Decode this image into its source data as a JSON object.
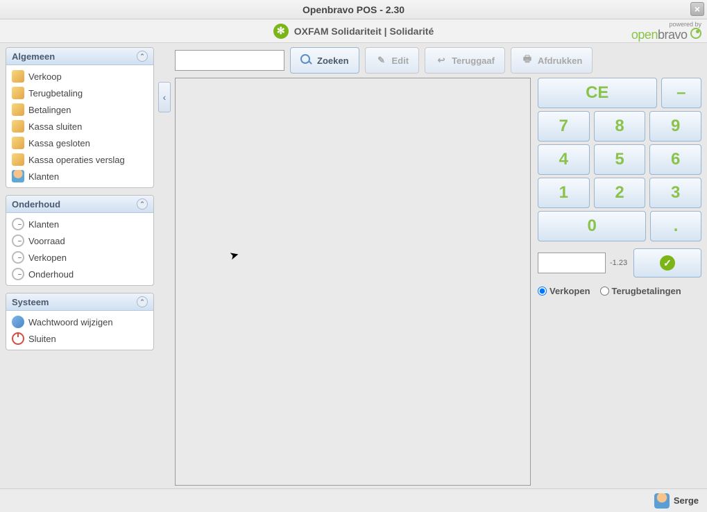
{
  "window": {
    "title": "Openbravo POS - 2.30"
  },
  "header": {
    "org": "OXFAM Solidariteit | Solidarité",
    "brand_small": "powered by",
    "brand_name1": "open",
    "brand_name2": "bravo"
  },
  "sidebar": {
    "sections": [
      {
        "title": "Algemeen",
        "items": [
          {
            "label": "Verkoop",
            "icon": "sale-icon"
          },
          {
            "label": "Terugbetaling",
            "icon": "refund-icon"
          },
          {
            "label": "Betalingen",
            "icon": "payments-icon"
          },
          {
            "label": "Kassa sluiten",
            "icon": "close-cash-icon"
          },
          {
            "label": "Kassa gesloten",
            "icon": "cash-closed-icon"
          },
          {
            "label": "Kassa operaties verslag",
            "icon": "cash-report-icon"
          },
          {
            "label": "Klanten",
            "icon": "customers-icon"
          }
        ]
      },
      {
        "title": "Onderhoud",
        "items": [
          {
            "label": "Klanten",
            "icon": "customers-maint-icon"
          },
          {
            "label": "Voorraad",
            "icon": "inventory-icon"
          },
          {
            "label": "Verkopen",
            "icon": "sales-maint-icon"
          },
          {
            "label": "Onderhoud",
            "icon": "maintenance-icon"
          }
        ]
      },
      {
        "title": "Systeem",
        "items": [
          {
            "label": "Wachtwoord wijzigen",
            "icon": "password-icon"
          },
          {
            "label": "Sluiten",
            "icon": "exit-icon"
          }
        ]
      }
    ]
  },
  "toolbar": {
    "search_value": "",
    "zoeken": "Zoeken",
    "edit": "Edit",
    "teruggaaf": "Teruggaaf",
    "afdrukken": "Afdrukken"
  },
  "keypad": {
    "ce": "CE",
    "minus": "–",
    "keys": [
      "7",
      "8",
      "9",
      "4",
      "5",
      "6",
      "1",
      "2",
      "3"
    ],
    "zero": "0",
    "dot": ".",
    "input_value": "",
    "hint": "-1.23"
  },
  "radios": {
    "verkopen": "Verkopen",
    "terugbetalingen": "Terugbetalingen",
    "selected": "verkopen"
  },
  "status": {
    "user": "Serge"
  }
}
